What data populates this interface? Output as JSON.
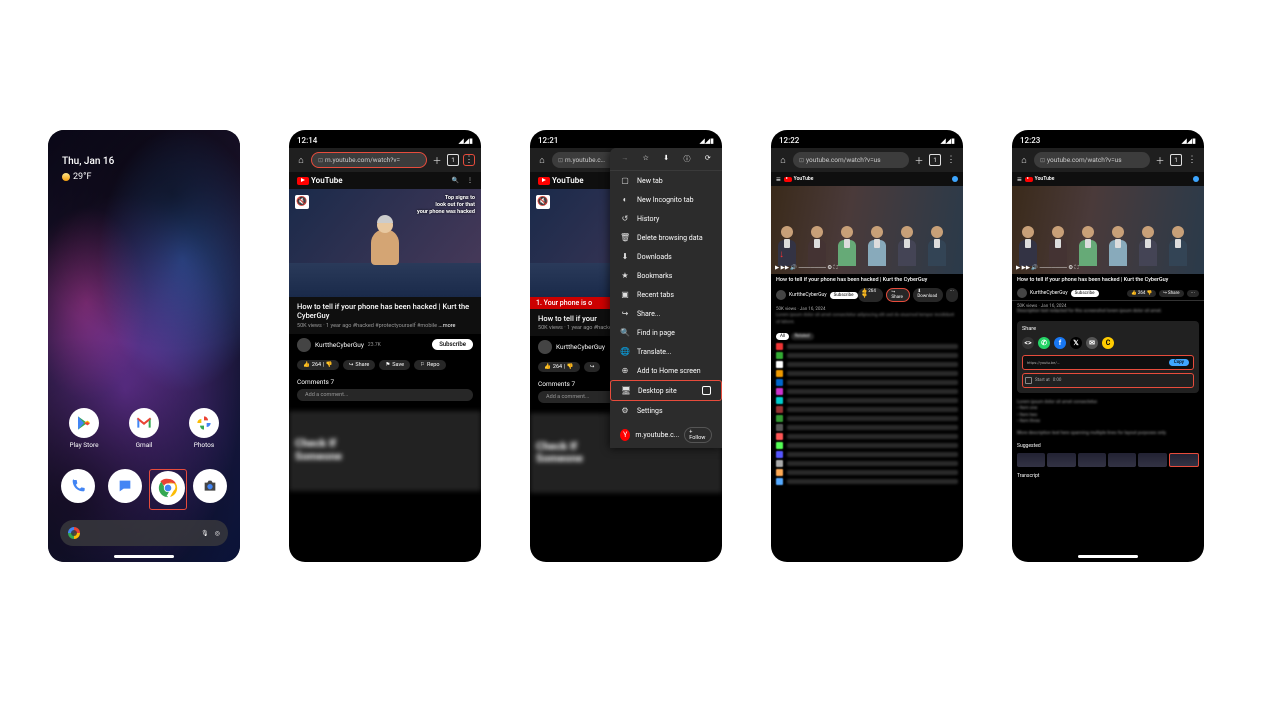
{
  "status": {
    "times": [
      "12:14",
      "12:14",
      "12:21",
      "12:22",
      "12:23"
    ],
    "icons": "◢◢▮"
  },
  "home": {
    "date": "Thu, Jan 16",
    "weather": "29°F",
    "apps": [
      {
        "name": "Play Store"
      },
      {
        "name": "Gmail"
      },
      {
        "name": "Photos"
      }
    ]
  },
  "chrome_bar": {
    "url_mobile": "m.youtube.com/watch?v=",
    "url_mobile_short": "m.youtube.c…",
    "url_desktop": "youtube.com/watch?v=us",
    "tab_count": "1"
  },
  "youtube": {
    "brand": "YouTube",
    "video": {
      "overlay_l1": "Top signs to",
      "overlay_l2": "look out for that",
      "overlay_l3": "your phone was hacked",
      "title": "How to tell if your phone has been hacked | Kurt the CyberGuy",
      "title_short": "How to tell if your",
      "stats": "50K views · 1 year ago  #hacked #protectyourself #mobile",
      "more": "...more",
      "banner": "1. Your phone is o"
    },
    "channel": {
      "name": "KurttheCyberGuy",
      "subs": "23.7K"
    },
    "subscribe": "Subscribe",
    "actions": {
      "like": "264",
      "share": "Share",
      "save": "Save",
      "report": "Repo"
    },
    "comments": {
      "header": "Comments 7",
      "placeholder": "Add a comment..."
    },
    "next": {
      "l1": "Check If",
      "l2": "Someone"
    }
  },
  "menu": {
    "items": [
      "New tab",
      "New Incognito tab",
      "History",
      "Delete browsing data",
      "Downloads",
      "Bookmarks",
      "Recent tabs",
      "Share...",
      "Find in page",
      "Translate...",
      "Add to Home screen",
      "Desktop site",
      "Settings"
    ],
    "shortcut": "m.youtube.c...",
    "follow": "+ Follow"
  },
  "desktop": {
    "title": "How to tell if your phone has been hacked | Kurt the CyberGuy",
    "channel": "KurttheCyberGuy",
    "subscribe": "Subscribe",
    "like": "264",
    "share": "Share",
    "download": "Download",
    "dateline": "50K views · Jan 16, 2024",
    "share_panel": {
      "title": "Share",
      "link": "https://youtu.be/…",
      "copy": "Copy",
      "start_at": "Start at",
      "time": "0:00"
    },
    "sections": {
      "suggested": "Suggested",
      "transcript": "Transcript"
    }
  }
}
